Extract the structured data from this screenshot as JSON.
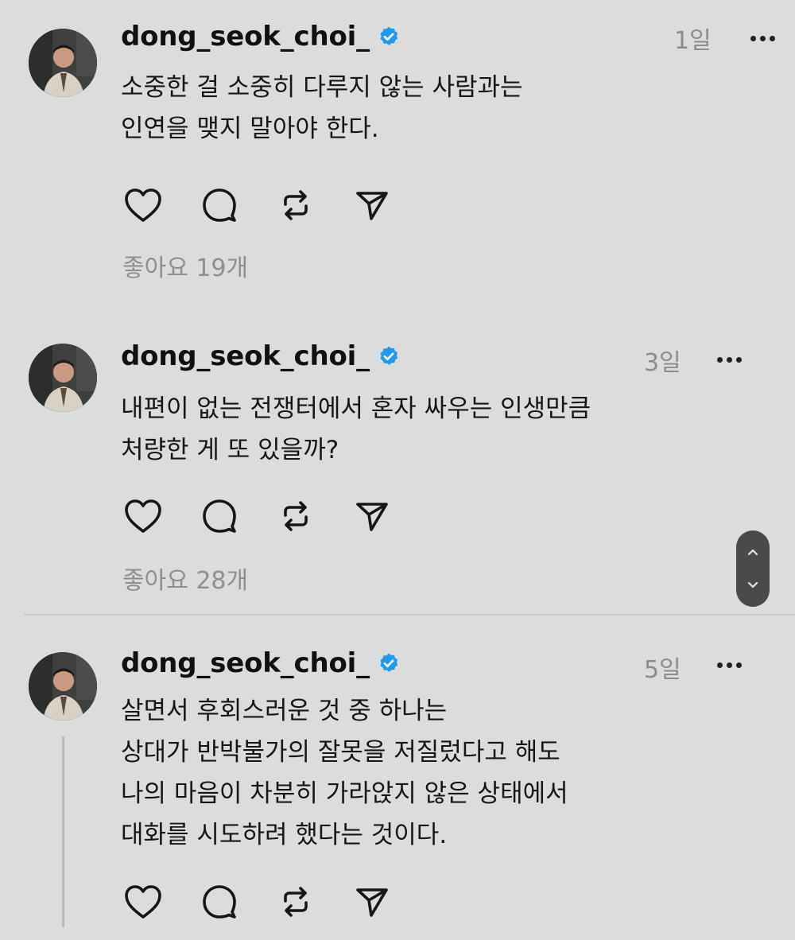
{
  "posts": [
    {
      "username": "dong_seok_choi_",
      "time": "1일",
      "text": "소중한 걸 소중히 다루지 않는 사람과는\n인연을 맺지 말아야 한다.",
      "likes": "좋아요 19개"
    },
    {
      "username": "dong_seok_choi_",
      "time": "3일",
      "text": "내편이 없는 전쟁터에서 혼자 싸우는 인생만큼\n처량한 게 또 있을까?",
      "likes": "좋아요 28개"
    },
    {
      "username": "dong_seok_choi_",
      "time": "5일",
      "text": "살면서 후회스러운 것 중 하나는\n상대가 반박불가의 잘못을 저질렀다고 해도\n나의 마음이 차분히 가라앉지 않은 상태에서\n대화를 시도하려 했다는 것이다."
    }
  ],
  "icons": {
    "verified": "verified-badge-icon",
    "like": "heart-icon",
    "comment": "comment-bubble-icon",
    "repost": "repost-icon",
    "share": "send-icon",
    "more": "more-dots-icon",
    "scroll_up": "chevron-up-icon",
    "scroll_down": "chevron-down-icon"
  },
  "colors": {
    "background": "#dcdcdc",
    "verified": "#1d9bf0",
    "muted_text": "#8d8d8d",
    "scroll_control": "#4a4a4a"
  }
}
